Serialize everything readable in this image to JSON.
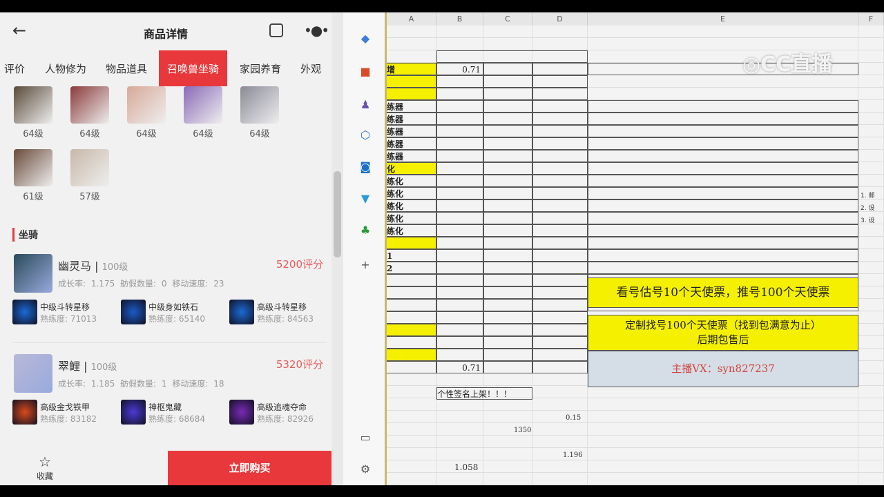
{
  "app": {
    "title": "商品详情",
    "tabs": [
      "评价",
      "人物修为",
      "物品道具",
      "召唤兽坐骑",
      "家园养育",
      "外观"
    ],
    "active_tab": "召唤兽坐骑",
    "summons": [
      "64级",
      "64级",
      "64级",
      "64级",
      "64级",
      "61级",
      "57级"
    ],
    "section_title": "坐骑",
    "mounts": [
      {
        "name": "幽灵马",
        "level": "100级",
        "score": "5200评分",
        "stats": "成长率: 1.175  舫假数量: 0  移动速度: 23",
        "skills": [
          {
            "name": "中级斗转星移",
            "prof": "熟练度: 71013"
          },
          {
            "name": "中级身如铁石",
            "prof": "熟练度: 65140"
          },
          {
            "name": "高级斗转星移",
            "prof": "熟练度: 84563"
          }
        ]
      },
      {
        "name": "翠鲤",
        "level": "100级",
        "score": "5320评分",
        "stats": "成长率: 1.185  舫假数量: 1  移动速度: 18",
        "skills": [
          {
            "name": "高级金戈铁甲",
            "prof": "熟练度: 83182"
          },
          {
            "name": "神枢鬼藏",
            "prof": "熟练度: 68684"
          },
          {
            "name": "高级追魂夺命",
            "prof": "熟练度: 82926"
          }
        ]
      }
    ],
    "fav_label": "收藏",
    "buy_label": "立即购买"
  },
  "sheet": {
    "columns": [
      "A",
      "B",
      "C",
      "D",
      "E",
      "F"
    ],
    "rows": [
      {
        "a": "增",
        "b": "0.71",
        "yellow": true
      },
      {
        "a": "",
        "yellow": true
      },
      {
        "a": "",
        "yellow": true
      },
      {
        "a": "练器"
      },
      {
        "a": "练器"
      },
      {
        "a": "练器"
      },
      {
        "a": "练器"
      },
      {
        "a": "练器"
      },
      {
        "a": "化",
        "yellow": true
      },
      {
        "a": "练化"
      },
      {
        "a": "练化"
      },
      {
        "a": "练化"
      },
      {
        "a": "练化"
      },
      {
        "a": "练化"
      },
      {
        "a": "",
        "yellow": true
      },
      {
        "a": "1"
      },
      {
        "a": "2"
      },
      {
        "a": ""
      },
      {
        "a": ""
      },
      {
        "a": ""
      },
      {
        "a": ""
      },
      {
        "a": "",
        "yellow": true
      },
      {
        "a": ""
      },
      {
        "a": "",
        "yellow": true
      },
      {
        "a": "",
        "b": "0.71"
      }
    ],
    "footer_text": "个性签名上架！！！",
    "merged": {
      "line1": "看号估号10个天使票，推号100个天使票",
      "line2a": "定制找号100个天使票（找到包满意为止）",
      "line2b": "后期包售后",
      "contact": "主播VX：syn827237"
    },
    "notes": [
      "1. 邮",
      "2. 设",
      "3. 设"
    ],
    "loose_values": [
      "0.15",
      "1350",
      "1.196",
      "1.058"
    ],
    "colors": {
      "yellow": "#f5f000",
      "contact_bg": "#d5dde6",
      "contact_text": "#d0433c"
    }
  },
  "watermark": "CC直播"
}
